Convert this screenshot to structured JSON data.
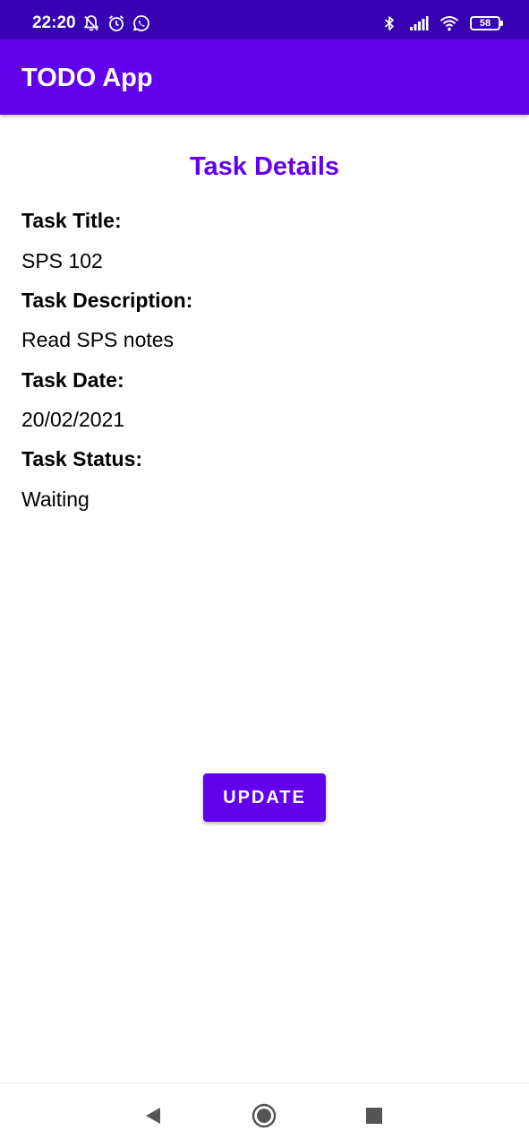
{
  "status_bar": {
    "time": "22:20",
    "battery_level": "58",
    "left_icons": [
      "notifications-off-icon",
      "alarm-icon",
      "whatsapp-icon"
    ],
    "right_icons": [
      "bluetooth-icon",
      "signal-icon",
      "wifi-icon",
      "battery-icon"
    ]
  },
  "app_bar": {
    "title": "TODO App"
  },
  "main": {
    "title": "Task Details",
    "fields": [
      {
        "label": "Task Title:",
        "value": "SPS 102"
      },
      {
        "label": "Task Description:",
        "value": "Read SPS notes"
      },
      {
        "label": "Task Date:",
        "value": "20/02/2021"
      },
      {
        "label": "Task Status:",
        "value": "Waiting"
      }
    ],
    "update_button_label": "UPDATE"
  },
  "nav_bar": {
    "buttons": [
      "back-icon",
      "home-icon",
      "recents-icon"
    ]
  },
  "colors": {
    "status_bar": "#3700B3",
    "primary": "#6200EE",
    "text": "#000000",
    "background": "#FFFFFF"
  }
}
